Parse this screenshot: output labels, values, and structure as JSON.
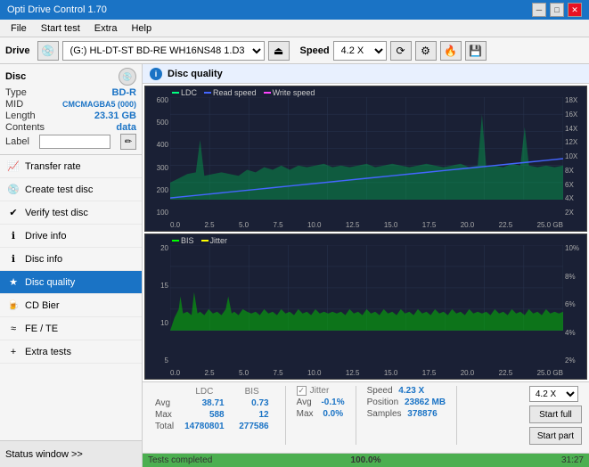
{
  "window": {
    "title": "Opti Drive Control 1.70",
    "minimize_label": "─",
    "maximize_label": "□",
    "close_label": "✕"
  },
  "menu": {
    "items": [
      "File",
      "Start test",
      "Extra",
      "Help"
    ]
  },
  "toolbar": {
    "drive_label": "Drive",
    "drive_value": "(G:) HL-DT-ST BD-RE  WH16NS48 1.D3",
    "speed_label": "Speed",
    "speed_value": "4.2 X"
  },
  "disc": {
    "title": "Disc",
    "type_label": "Type",
    "type_value": "BD-R",
    "mid_label": "MID",
    "mid_value": "CMCMAGBA5 (000)",
    "length_label": "Length",
    "length_value": "23.31 GB",
    "contents_label": "Contents",
    "contents_value": "data",
    "label_label": "Label",
    "label_placeholder": ""
  },
  "nav": {
    "items": [
      {
        "id": "transfer-rate",
        "label": "Transfer rate",
        "active": false
      },
      {
        "id": "create-test-disc",
        "label": "Create test disc",
        "active": false
      },
      {
        "id": "verify-test-disc",
        "label": "Verify test disc",
        "active": false
      },
      {
        "id": "drive-info",
        "label": "Drive info",
        "active": false
      },
      {
        "id": "disc-info",
        "label": "Disc info",
        "active": false
      },
      {
        "id": "disc-quality",
        "label": "Disc quality",
        "active": true
      },
      {
        "id": "cd-bier",
        "label": "CD Bier",
        "active": false
      },
      {
        "id": "fe-te",
        "label": "FE / TE",
        "active": false
      },
      {
        "id": "extra-tests",
        "label": "Extra tests",
        "active": false
      }
    ]
  },
  "status_window": {
    "label": "Status window >>"
  },
  "quality": {
    "title": "Disc quality",
    "icon": "i",
    "legend": {
      "ldc_label": "LDC",
      "read_speed_label": "Read speed",
      "write_speed_label": "Write speed",
      "bis_label": "BIS",
      "jitter_label": "Jitter"
    }
  },
  "chart1": {
    "y_left": [
      "600",
      "500",
      "400",
      "300",
      "200",
      "100"
    ],
    "y_right": [
      "18X",
      "16X",
      "14X",
      "12X",
      "10X",
      "8X",
      "6X",
      "4X",
      "2X"
    ],
    "x_labels": [
      "0.0",
      "2.5",
      "5.0",
      "7.5",
      "10.0",
      "12.5",
      "15.0",
      "17.5",
      "20.0",
      "22.5",
      "25.0 GB"
    ]
  },
  "chart2": {
    "y_left": [
      "20",
      "15",
      "10",
      "5"
    ],
    "y_right": [
      "10%",
      "8%",
      "6%",
      "4%",
      "2%"
    ],
    "x_labels": [
      "0.0",
      "2.5",
      "5.0",
      "7.5",
      "10.0",
      "12.5",
      "15.0",
      "17.5",
      "20.0",
      "22.5",
      "25.0 GB"
    ]
  },
  "stats": {
    "headers": [
      "LDC",
      "BIS",
      "",
      "Jitter",
      "Speed",
      ""
    ],
    "avg_label": "Avg",
    "avg_ldc": "38.71",
    "avg_bis": "0.73",
    "avg_jitter": "-0.1%",
    "max_label": "Max",
    "max_ldc": "588",
    "max_bis": "12",
    "max_jitter": "0.0%",
    "total_label": "Total",
    "total_ldc": "14780801",
    "total_bis": "277586",
    "speed_label": "Speed",
    "speed_value": "4.23 X",
    "position_label": "Position",
    "position_value": "23862 MB",
    "samples_label": "Samples",
    "samples_value": "378876",
    "jitter_checked": true,
    "jitter_label": "Jitter",
    "speed_select_value": "4.2 X",
    "start_full_label": "Start full",
    "start_part_label": "Start part"
  },
  "progress": {
    "status": "Tests completed",
    "percent": "100.0%",
    "percent_num": 100,
    "time": "31:27"
  },
  "colors": {
    "ldc_color": "#00ff80",
    "read_speed_color": "#4040ff",
    "write_speed_color": "#ff00ff",
    "bis_color": "#00ff00",
    "jitter_color": "#ffff00",
    "accent": "#1a73c5",
    "chart_bg": "#1a2035"
  }
}
